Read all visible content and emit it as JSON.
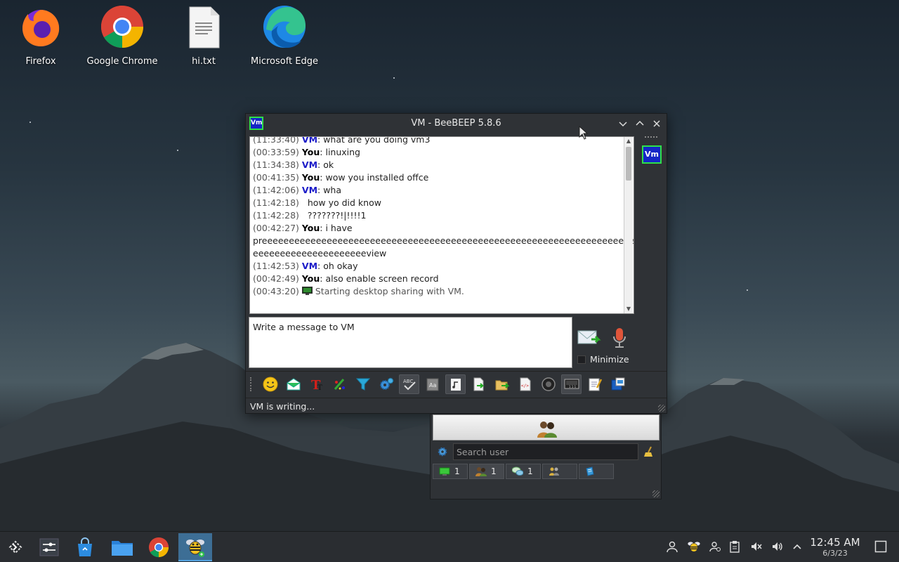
{
  "desktop": {
    "icons": [
      {
        "label": "Firefox"
      },
      {
        "label": "Google Chrome"
      },
      {
        "label": "hi.txt"
      },
      {
        "label": "Microsoft Edge"
      }
    ]
  },
  "chat_window": {
    "title": "VM - BeeBEEP 5.8.6",
    "badge": "Vm",
    "messages": [
      {
        "ts": "(11:33:40)",
        "sender": "VM",
        "text": "what are you doing vm3"
      },
      {
        "ts": "(00:33:59)",
        "sender": "You",
        "text": "linuxing"
      },
      {
        "ts": "(11:34:38)",
        "sender": "VM",
        "text": "ok"
      },
      {
        "ts": "(00:41:35)",
        "sender": "You",
        "text": "wow you installed offce"
      },
      {
        "ts": "(11:42:06)",
        "sender": "VM",
        "text": "wha"
      },
      {
        "ts": "(11:42:18)",
        "sender": "",
        "text": "how yo did know"
      },
      {
        "ts": "(11:42:28)",
        "sender": "",
        "text": "???????!|!!!!1"
      },
      {
        "ts": "(00:42:27)",
        "sender": "You",
        "text": "i have"
      },
      {
        "ts": "",
        "sender": "",
        "text": "preeeeeeeeeeeeeeeeeeeeeeeeeeeeeeeeeeeeeeeeeeeeeeeeeeeeeeeeeeeeeeeeeeeeeeeeee"
      },
      {
        "ts": "",
        "sender": "",
        "text": "eeeeeeeeeeeeeeeeeeeeeview"
      },
      {
        "ts": "(11:42:53)",
        "sender": "VM",
        "text": "oh okay"
      },
      {
        "ts": "(00:42:49)",
        "sender": "You",
        "text": "also enable screen record"
      },
      {
        "ts": "(00:43:20)",
        "sender": "",
        "text": "Starting desktop sharing with VM."
      }
    ],
    "input_placeholder": "Write a message to VM",
    "minimize_label": "Minimize",
    "status": "VM is writing...",
    "sidebar_badge": "Vm"
  },
  "users_window": {
    "search_placeholder": "Search user",
    "tabs": [
      {
        "count": "1"
      },
      {
        "count": "1"
      },
      {
        "count": "1"
      },
      {
        "count": ""
      },
      {
        "count": ""
      }
    ]
  },
  "taskbar": {
    "time": "12:45 AM",
    "date": "6/3/23"
  },
  "colors": {
    "accent": "#1526c6",
    "badge_border": "#2ee04a",
    "vm_name": "#1a1ac8"
  }
}
